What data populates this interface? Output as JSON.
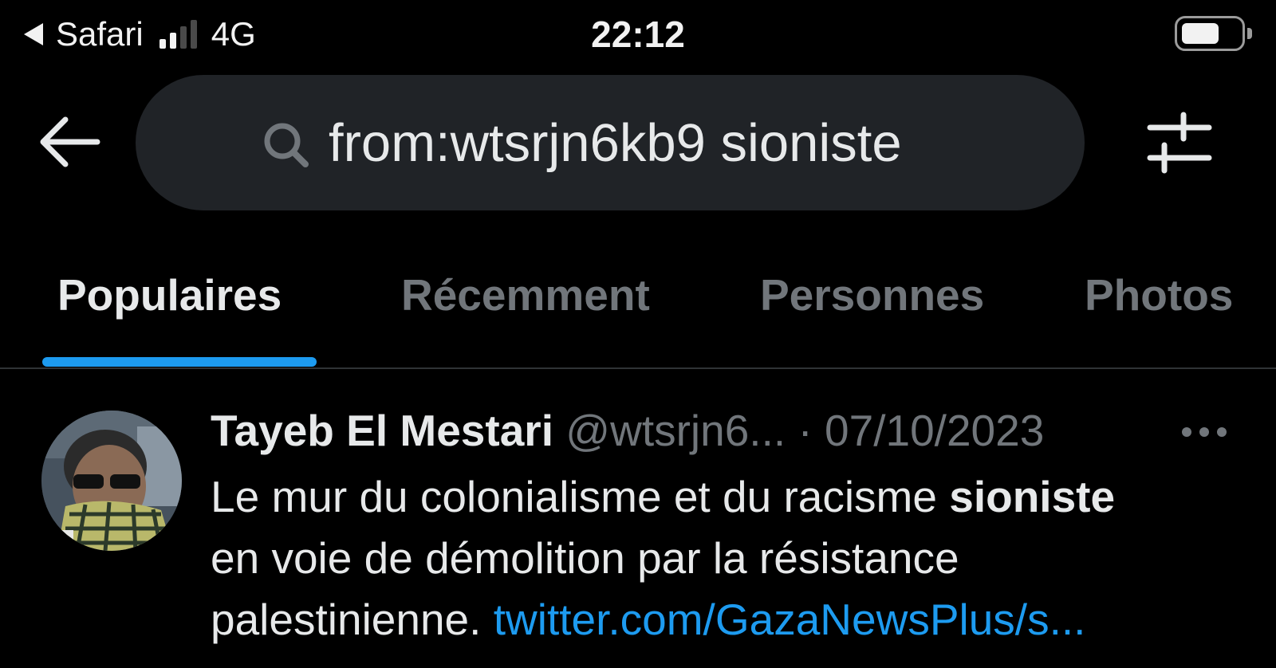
{
  "status_bar": {
    "back_app": "Safari",
    "network": "4G",
    "time": "22:12",
    "signal_bars_active": 2,
    "signal_bars_total": 4,
    "battery_level": 0.6
  },
  "search": {
    "query": "from:wtsrjn6kb9 sioniste",
    "icon": "search-icon"
  },
  "tabs": [
    {
      "label": "Populaires",
      "active": true
    },
    {
      "label": "Récemment",
      "active": false
    },
    {
      "label": "Personnes",
      "active": false
    },
    {
      "label": "Photos",
      "active": false
    }
  ],
  "tweet": {
    "author_name": "Tayeb El Mestari",
    "handle": "@wtsrjn6...",
    "separator": "·",
    "date": "07/10/2023",
    "text_line1_before": "Le mur du colonialisme et du racisme ",
    "text_line1_highlight": "sioniste",
    "text_line2": "en voie de démolition par la résistance",
    "text_line3_before": "palestinienne. ",
    "link": "twitter.com/GazaNewsPlus/s..."
  },
  "colors": {
    "background": "#000000",
    "accent": "#1d9bf0",
    "secondary_text": "#71767b",
    "primary_text": "#e7e9ea",
    "search_bg": "#202327"
  }
}
